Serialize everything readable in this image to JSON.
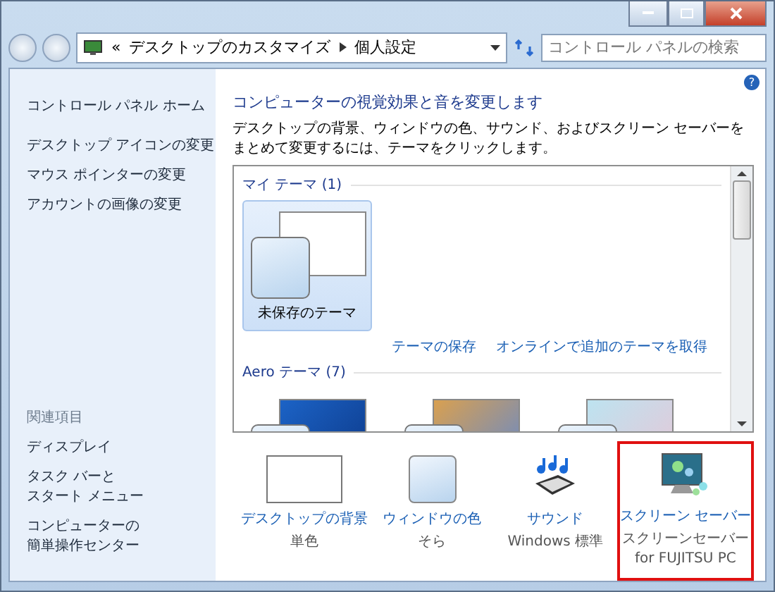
{
  "address_bar": {
    "overflow": "«",
    "breadcrumbs": [
      "デスクトップのカスタマイズ",
      "個人設定"
    ]
  },
  "search": {
    "placeholder": "コントロール パネルの検索"
  },
  "sidebar": {
    "home": "コントロール パネル ホーム",
    "links": [
      "デスクトップ アイコンの変更",
      "マウス ポインターの変更",
      "アカウントの画像の変更"
    ],
    "related_heading": "関連項目",
    "related": [
      [
        "ディスプレイ"
      ],
      [
        "タスク バーと",
        "スタート メニュー"
      ],
      [
        "コンピューターの",
        "簡単操作センター"
      ]
    ]
  },
  "help": "?",
  "main": {
    "heading": "コンピューターの視覚効果と音を変更します",
    "description": "デスクトップの背景、ウィンドウの色、サウンド、およびスクリーン セーバーをまとめて変更するには、テーマをクリックします。",
    "theme_groups": [
      {
        "title": "マイ テーマ",
        "count": "(1)",
        "themes": [
          {
            "kind": "blank",
            "name": "未保存のテーマ",
            "selected": true
          }
        ],
        "links": [
          "テーマの保存",
          "オンラインで追加のテーマを取得"
        ]
      },
      {
        "title": "Aero テーマ",
        "count": "(7)",
        "themes": [
          {
            "kind": "windows",
            "selected": false
          },
          {
            "kind": "landscape",
            "selected": false
          },
          {
            "kind": "floral",
            "selected": false
          }
        ]
      }
    ],
    "settings": [
      {
        "kind": "background",
        "label": "デスクトップの背景",
        "value": "単色",
        "highlighted": false
      },
      {
        "kind": "color",
        "label": "ウィンドウの色",
        "value": "そら",
        "highlighted": false
      },
      {
        "kind": "sound",
        "label": "サウンド",
        "value": "Windows 標準",
        "highlighted": false
      },
      {
        "kind": "screensaver",
        "label": "スクリーン セーバー",
        "value": "スクリーンセーバー for FUJITSU PC",
        "highlighted": true
      }
    ]
  }
}
